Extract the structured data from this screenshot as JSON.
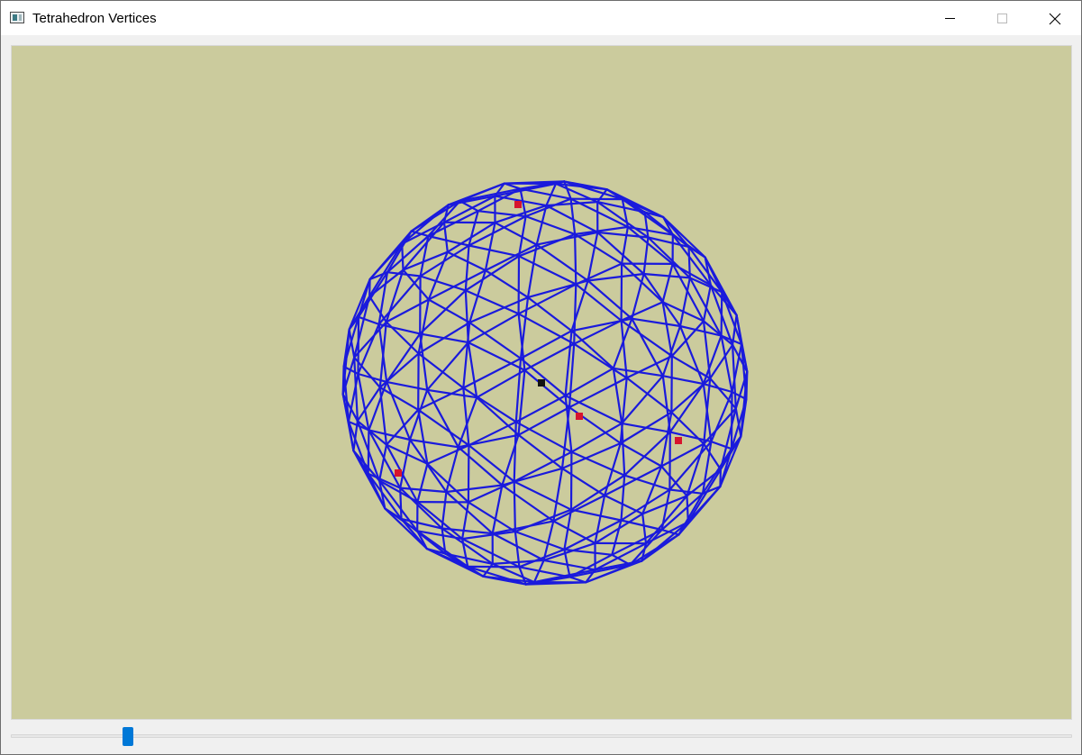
{
  "window": {
    "title": "Tetrahedron Vertices"
  },
  "caption_buttons": {
    "minimize_icon": "minimize-icon",
    "maximize_icon": "maximize-icon",
    "close_icon": "close-icon"
  },
  "viewport": {
    "background_color": "#cbcb9d",
    "wire_color": "#1a1adc",
    "vertex_marker_color": "#d7142d",
    "center_marker_color": "#111111",
    "vertex_marker_count": 4
  },
  "slider": {
    "value_fraction": 0.106,
    "accent_color": "#0078d7"
  }
}
